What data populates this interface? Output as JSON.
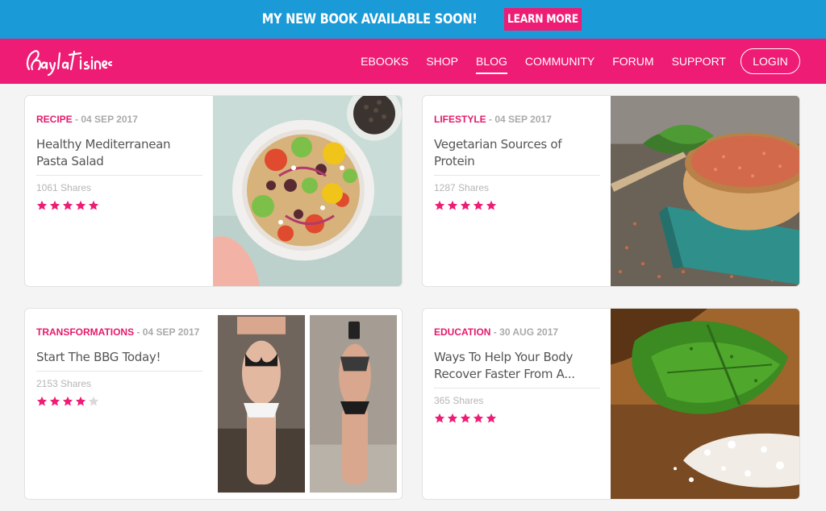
{
  "promo": {
    "text": "MY NEW BOOK AVAILABLE SOON!",
    "button_label": "LEARN MORE",
    "background_color": "#1a9ad6",
    "button_color": "#ee1c74"
  },
  "nav": {
    "logo_text": "Kayla Itsines",
    "background_color": "#ee1c74",
    "links": [
      {
        "label": "EBOOKS",
        "active": false
      },
      {
        "label": "SHOP",
        "active": false
      },
      {
        "label": "BLOG",
        "active": true
      },
      {
        "label": "COMMUNITY",
        "active": false
      },
      {
        "label": "FORUM",
        "active": false
      },
      {
        "label": "SUPPORT",
        "active": false
      }
    ],
    "login_label": "LOGIN"
  },
  "cards": [
    {
      "category": "RECIPE",
      "date": "04 SEP 2017",
      "title": "Healthy Mediterranean Pasta Salad",
      "shares": "1061 Shares",
      "rating": 5,
      "image": "pasta-salad-bowl"
    },
    {
      "category": "LIFESTYLE",
      "date": "04 SEP 2017",
      "title": "Vegetarian Sources of Protein",
      "shares": "1287 Shares",
      "rating": 5,
      "image": "lentils-bowl"
    },
    {
      "category": "TRANSFORMATIONS",
      "date": "04 SEP 2017",
      "title": "Start The BBG Today!",
      "shares": "2153 Shares",
      "rating": 4,
      "image": "before-after-photos"
    },
    {
      "category": "EDUCATION",
      "date": "30 AUG 2017",
      "title": "Ways To Help Your Body Recover Faster From A...",
      "shares": "365 Shares",
      "rating": 5,
      "image": "leaf-and-salt"
    }
  ],
  "colors": {
    "accent": "#e51a6c",
    "star_filled": "#ee1c74",
    "star_empty": "#d9d9d9"
  }
}
